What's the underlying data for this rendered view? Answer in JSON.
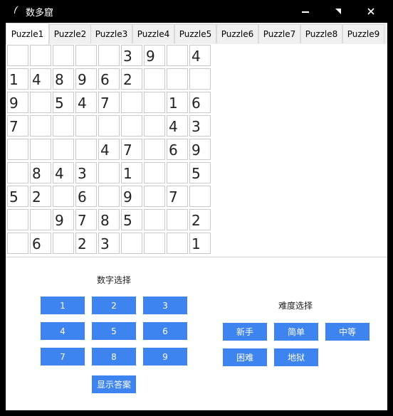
{
  "window": {
    "title": "数多窟",
    "buttons": [
      "minimize",
      "maximize",
      "close"
    ]
  },
  "tabs": [
    "Puzzle1",
    "Puzzle2",
    "Puzzle3",
    "Puzzle4",
    "Puzzle5",
    "Puzzle6",
    "Puzzle7",
    "Puzzle8",
    "Puzzle9"
  ],
  "active_tab": 0,
  "board": [
    [
      "",
      "",
      "",
      "",
      "",
      "3",
      "9",
      "",
      "4"
    ],
    [
      "1",
      "4",
      "8",
      "9",
      "6",
      "2",
      "",
      "",
      ""
    ],
    [
      "9",
      "",
      "5",
      "4",
      "7",
      "",
      "",
      "1",
      "6"
    ],
    [
      "7",
      "",
      "",
      "",
      "",
      "",
      "",
      "4",
      "3"
    ],
    [
      "",
      "",
      "",
      "",
      "4",
      "7",
      "",
      "6",
      "9"
    ],
    [
      "",
      "8",
      "4",
      "3",
      "",
      "1",
      "",
      "",
      "5"
    ],
    [
      "5",
      "2",
      "",
      "6",
      "",
      "9",
      "",
      "7",
      ""
    ],
    [
      "",
      "",
      "9",
      "7",
      "8",
      "5",
      "",
      "",
      "2"
    ],
    [
      "",
      "6",
      "",
      "2",
      "3",
      "",
      "",
      "",
      "1"
    ]
  ],
  "number_select": {
    "title": "数字选择",
    "buttons": [
      "1",
      "2",
      "3",
      "4",
      "5",
      "6",
      "7",
      "8",
      "9"
    ],
    "show_answer": "显示答案"
  },
  "difficulty_select": {
    "title": "难度选择",
    "buttons": [
      "新手",
      "简单",
      "中等",
      "困难",
      "地狱"
    ]
  },
  "colors": {
    "button": "#3e84f0",
    "titlebar": "#000000"
  }
}
